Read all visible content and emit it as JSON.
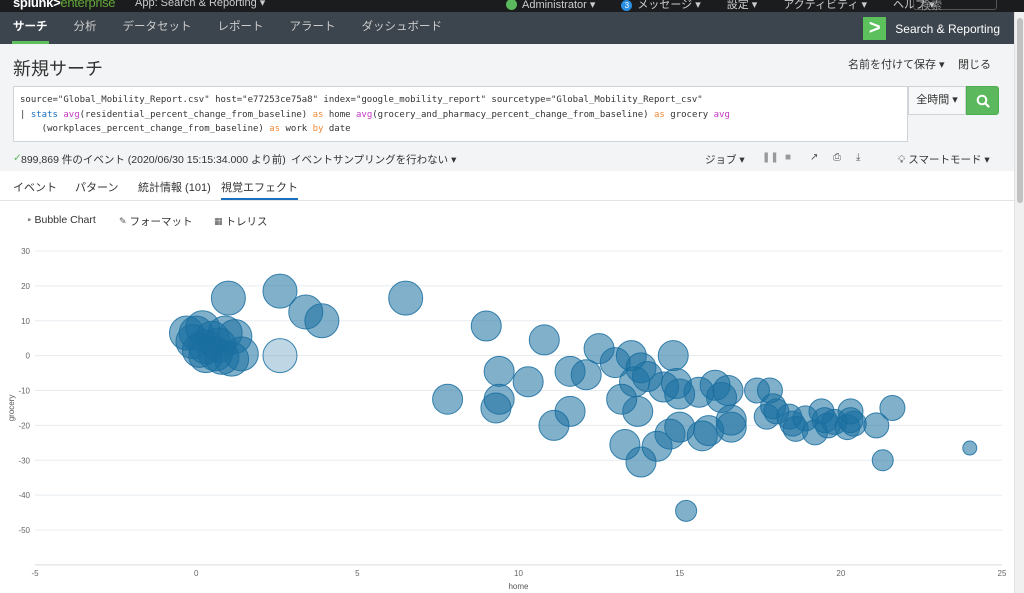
{
  "topbar": {
    "logo_main": "splunk>",
    "logo_sub": "enterprise",
    "app_label": "App: Search & Reporting ▾",
    "user_label": "Administrator ▾",
    "messages_count": "3",
    "messages_label": "メッセージ ▾",
    "settings_label": "設定 ▾",
    "activity_label": "アクティビティ ▾",
    "help_label": "ヘルプ ▾",
    "search_placeholder": "検索"
  },
  "appbar": {
    "nav": [
      "サーチ",
      "分析",
      "データセット",
      "レポート",
      "アラート",
      "ダッシュボード"
    ],
    "active_index": 0,
    "brand_label": "Search & Reporting",
    "brand_glyph": ">"
  },
  "header": {
    "title": "新規サーチ",
    "save_as_label": "名前を付けて保存 ▾",
    "close_label": "閉じる"
  },
  "search": {
    "line1": "source=\"Global_Mobility_Report.csv\" host=\"e77253ce75a8\" index=\"google_mobility_report\" sourcetype=\"Global_Mobility_Report_csv\"",
    "line2_pipe": "| ",
    "line2_cmd": "stats",
    "line2_fn1": "avg",
    "line2_arg1": "(residential_percent_change_from_baseline) ",
    "line2_as1": "as",
    "line2_alias1": " home ",
    "line2_fn2": "avg",
    "line2_arg2": "(grocery_and_pharmacy_percent_change_from_baseline) ",
    "line2_as2": "as",
    "line2_alias2": " grocery ",
    "line2_fn3": "avg",
    "line3_arg3": "    (workplaces_percent_change_from_baseline) ",
    "line3_as3": "as",
    "line3_alias3": " work ",
    "line3_by": "by",
    "line3_field": " date",
    "time_range": "全時間 ▾"
  },
  "status": {
    "check": "✓",
    "event_count": "899,869 件のイベント (2020/06/30 15:15:34.000 より前)",
    "sampling": "イベントサンプリングを行わない ▾",
    "job": "ジョブ ▾",
    "smart_mode": "スマートモード ▾"
  },
  "tabs": [
    {
      "label": "イベント"
    },
    {
      "label": "パターン"
    },
    {
      "label": "統計情報 (101)"
    },
    {
      "label": "視覚エフェクト"
    }
  ],
  "active_tab": 3,
  "viz_toolbar": {
    "chart_type": "Bubble Chart",
    "format": "フォーマット",
    "trellis": "トレリス"
  },
  "colors": {
    "bubble": "#1a6fa0",
    "accent_green": "#5cb85c",
    "active_tab": "#1a6fbf"
  },
  "chart_data": {
    "type": "scatter",
    "subtype": "bubble",
    "title": "",
    "xlabel": "home",
    "ylabel": "grocery",
    "xlim": [
      -5,
      25
    ],
    "ylim": [
      -60,
      30
    ],
    "x_ticks": [
      -5,
      0,
      5,
      10,
      15,
      20,
      25
    ],
    "y_ticks": [
      30,
      20,
      10,
      0,
      -10,
      -20,
      -30,
      -40,
      -50
    ],
    "grid": true,
    "legend": "none",
    "points": [
      {
        "x": 0.0,
        "y": 6.5,
        "size": "large"
      },
      {
        "x": -0.3,
        "y": 6.5,
        "size": "large"
      },
      {
        "x": 0.2,
        "y": 8.0,
        "size": "large"
      },
      {
        "x": -0.1,
        "y": 4.0,
        "size": "large"
      },
      {
        "x": 0.3,
        "y": 2.5,
        "size": "large"
      },
      {
        "x": 0.5,
        "y": 5.0,
        "size": "large"
      },
      {
        "x": 0.1,
        "y": 1.5,
        "size": "large"
      },
      {
        "x": 0.7,
        "y": 3.0,
        "size": "large"
      },
      {
        "x": 0.9,
        "y": 6.5,
        "size": "large"
      },
      {
        "x": 0.6,
        "y": 0.5,
        "size": "large"
      },
      {
        "x": 0.3,
        "y": 0.0,
        "size": "large"
      },
      {
        "x": 1.2,
        "y": 5.5,
        "size": "large"
      },
      {
        "x": 1.4,
        "y": 0.5,
        "size": "large"
      },
      {
        "x": 1.1,
        "y": -1.0,
        "size": "large"
      },
      {
        "x": 0.8,
        "y": -0.5,
        "size": "large"
      },
      {
        "x": 1.0,
        "y": 16.5,
        "size": "large"
      },
      {
        "x": 2.6,
        "y": 18.5,
        "size": "large"
      },
      {
        "x": 3.4,
        "y": 12.5,
        "size": "large"
      },
      {
        "x": 3.9,
        "y": 10.0,
        "size": "large"
      },
      {
        "x": 2.6,
        "y": 0.0,
        "size": "large",
        "faded": true
      },
      {
        "x": 6.5,
        "y": 16.5,
        "size": "large"
      },
      {
        "x": 9.0,
        "y": 8.5,
        "size": "medium"
      },
      {
        "x": 10.8,
        "y": 4.5,
        "size": "medium"
      },
      {
        "x": 7.8,
        "y": -12.5,
        "size": "medium"
      },
      {
        "x": 9.4,
        "y": -4.5,
        "size": "medium"
      },
      {
        "x": 9.4,
        "y": -12.5,
        "size": "medium"
      },
      {
        "x": 9.3,
        "y": -15.0,
        "size": "medium"
      },
      {
        "x": 10.3,
        "y": -7.5,
        "size": "medium"
      },
      {
        "x": 11.6,
        "y": -4.5,
        "size": "medium"
      },
      {
        "x": 12.1,
        "y": -5.5,
        "size": "medium"
      },
      {
        "x": 12.5,
        "y": 2.0,
        "size": "medium"
      },
      {
        "x": 11.6,
        "y": -16.0,
        "size": "medium"
      },
      {
        "x": 11.1,
        "y": -20.0,
        "size": "medium"
      },
      {
        "x": 13.0,
        "y": -2.0,
        "size": "medium"
      },
      {
        "x": 13.5,
        "y": 0.0,
        "size": "medium"
      },
      {
        "x": 13.8,
        "y": -3.5,
        "size": "medium"
      },
      {
        "x": 13.6,
        "y": -7.5,
        "size": "medium"
      },
      {
        "x": 14.0,
        "y": -6.0,
        "size": "medium"
      },
      {
        "x": 13.2,
        "y": -12.5,
        "size": "medium"
      },
      {
        "x": 13.7,
        "y": -16.0,
        "size": "medium"
      },
      {
        "x": 14.8,
        "y": 0.0,
        "size": "medium"
      },
      {
        "x": 14.5,
        "y": -9.0,
        "size": "medium"
      },
      {
        "x": 14.9,
        "y": -8.0,
        "size": "medium"
      },
      {
        "x": 15.0,
        "y": -11.0,
        "size": "medium"
      },
      {
        "x": 15.6,
        "y": -10.5,
        "size": "medium"
      },
      {
        "x": 16.1,
        "y": -8.5,
        "size": "medium"
      },
      {
        "x": 16.5,
        "y": -10.0,
        "size": "medium"
      },
      {
        "x": 16.3,
        "y": -12.0,
        "size": "medium"
      },
      {
        "x": 13.3,
        "y": -25.5,
        "size": "medium"
      },
      {
        "x": 13.8,
        "y": -30.5,
        "size": "medium"
      },
      {
        "x": 14.3,
        "y": -26.0,
        "size": "medium"
      },
      {
        "x": 14.7,
        "y": -22.5,
        "size": "medium"
      },
      {
        "x": 15.0,
        "y": -20.5,
        "size": "medium"
      },
      {
        "x": 15.7,
        "y": -23.0,
        "size": "medium"
      },
      {
        "x": 15.9,
        "y": -21.5,
        "size": "medium"
      },
      {
        "x": 16.6,
        "y": -18.5,
        "size": "medium"
      },
      {
        "x": 16.6,
        "y": -20.5,
        "size": "medium"
      },
      {
        "x": 17.4,
        "y": -10.0,
        "size": "small"
      },
      {
        "x": 17.8,
        "y": -10.0,
        "size": "small"
      },
      {
        "x": 17.9,
        "y": -14.5,
        "size": "small"
      },
      {
        "x": 18.0,
        "y": -16.0,
        "size": "small"
      },
      {
        "x": 17.7,
        "y": -17.5,
        "size": "small"
      },
      {
        "x": 18.4,
        "y": -17.5,
        "size": "small"
      },
      {
        "x": 18.5,
        "y": -19.5,
        "size": "small"
      },
      {
        "x": 18.6,
        "y": -21.0,
        "size": "small"
      },
      {
        "x": 18.9,
        "y": -18.0,
        "size": "small"
      },
      {
        "x": 19.2,
        "y": -22.0,
        "size": "small"
      },
      {
        "x": 19.4,
        "y": -16.0,
        "size": "small"
      },
      {
        "x": 19.5,
        "y": -18.5,
        "size": "small"
      },
      {
        "x": 19.6,
        "y": -20.0,
        "size": "small"
      },
      {
        "x": 19.8,
        "y": -19.0,
        "size": "small"
      },
      {
        "x": 20.3,
        "y": -16.0,
        "size": "small"
      },
      {
        "x": 20.3,
        "y": -18.5,
        "size": "small"
      },
      {
        "x": 20.4,
        "y": -19.5,
        "size": "small"
      },
      {
        "x": 20.2,
        "y": -20.5,
        "size": "small"
      },
      {
        "x": 21.1,
        "y": -20.0,
        "size": "small"
      },
      {
        "x": 21.6,
        "y": -15.0,
        "size": "small"
      },
      {
        "x": 21.3,
        "y": -30.0,
        "size": "xsmall"
      },
      {
        "x": 15.2,
        "y": -44.5,
        "size": "xsmall"
      },
      {
        "x": 24.0,
        "y": -26.5,
        "size": "xxsmall"
      }
    ]
  }
}
